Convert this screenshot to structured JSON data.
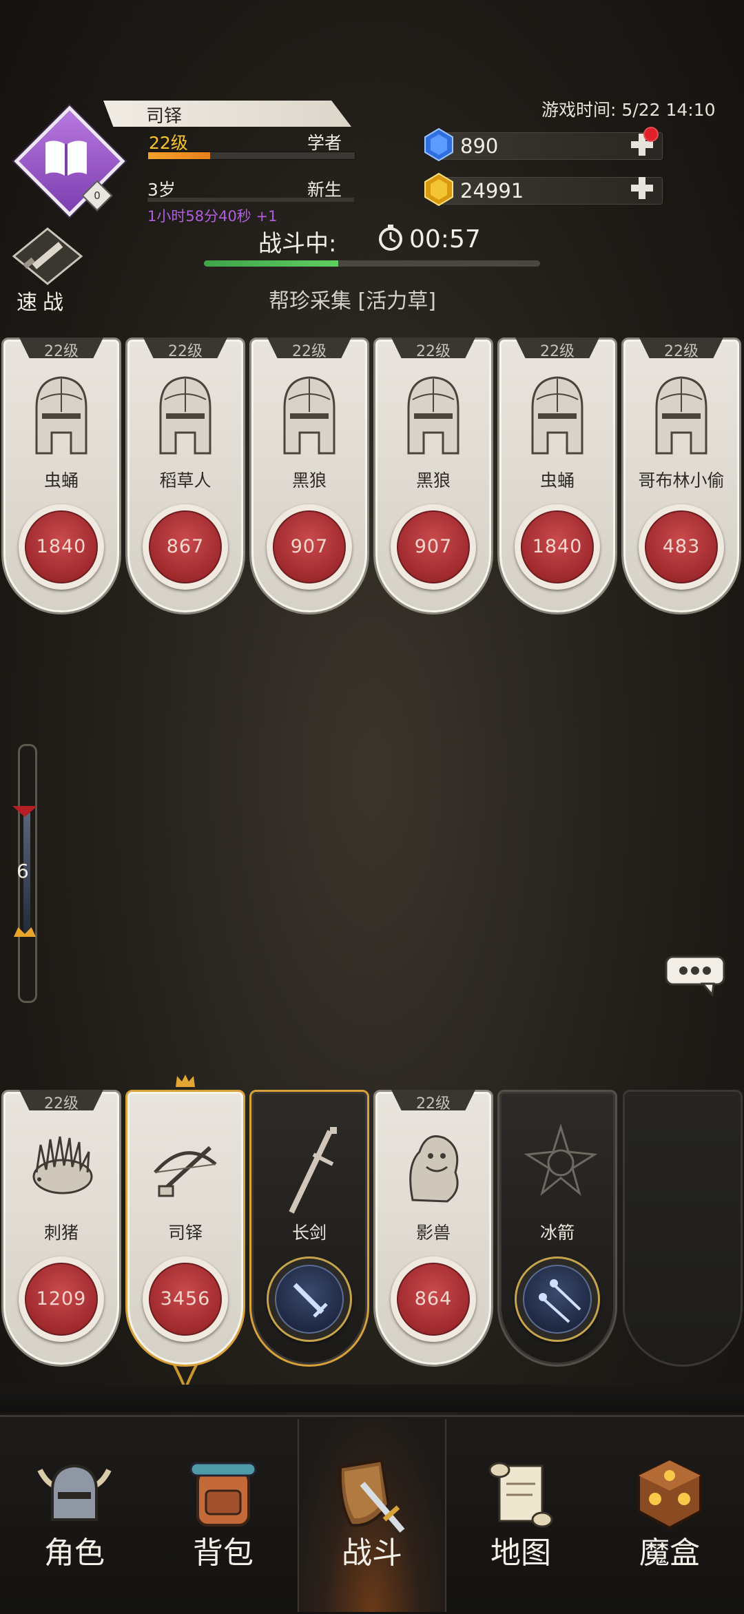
{
  "header": {
    "game_time": "游戏时间: 5/22 14:10",
    "player_name": "司铎",
    "level": "22级",
    "class": "学者",
    "level_progress": 0.3,
    "age": "3岁",
    "age_stage": "新生",
    "age_timer": "1小时58分40秒 +1",
    "avatar_badge": "0",
    "gems": "890",
    "gold": "24991"
  },
  "battle": {
    "quick_battle_label": "速战",
    "status_label": "战斗中:",
    "timer": "00:57",
    "progress": 0.4,
    "quest": "帮珍采集 [活力草]"
  },
  "enemies": [
    {
      "level": "22级",
      "name": "虫蛹",
      "hp": "1840"
    },
    {
      "level": "22级",
      "name": "稻草人",
      "hp": "867"
    },
    {
      "level": "22级",
      "name": "黑狼",
      "hp": "907"
    },
    {
      "level": "22级",
      "name": "黑狼",
      "hp": "907"
    },
    {
      "level": "22级",
      "name": "虫蛹",
      "hp": "1840"
    },
    {
      "level": "22级",
      "name": "哥布林小偷",
      "hp": "483"
    }
  ],
  "gauge": {
    "value": "6"
  },
  "party": [
    {
      "level": "22级",
      "name": "刺猪",
      "hp": "1209",
      "icon": "porcupine-icon"
    },
    {
      "level": "",
      "name": "司铎",
      "hp": "3456",
      "icon": "crossbow-icon"
    },
    {
      "level": "",
      "name": "长剑",
      "hp": "",
      "icon": "sword-icon"
    },
    {
      "level": "22级",
      "name": "影兽",
      "hp": "864",
      "icon": "shadow-beast-icon"
    },
    {
      "level": "",
      "name": "冰箭",
      "hp": "",
      "icon": "ice-arrow-icon"
    }
  ],
  "nav": [
    {
      "label": "角色",
      "icon": "helmet-icon"
    },
    {
      "label": "背包",
      "icon": "backpack-icon"
    },
    {
      "label": "战斗",
      "icon": "shield-sword-icon"
    },
    {
      "label": "地图",
      "icon": "scroll-map-icon"
    },
    {
      "label": "魔盒",
      "icon": "magic-cube-icon"
    }
  ]
}
